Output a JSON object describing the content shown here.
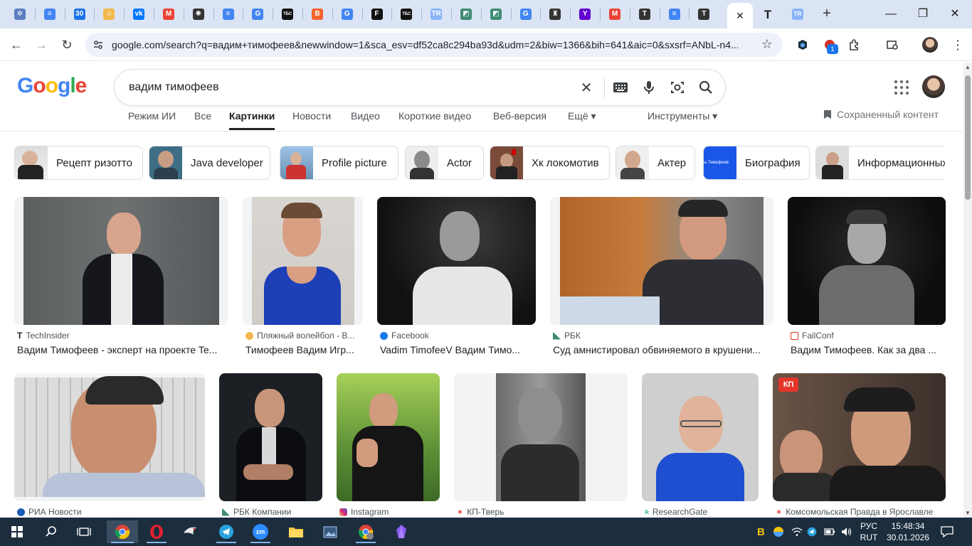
{
  "browser": {
    "tabs": [
      {
        "icon": "puzzle-tab-icon",
        "color": "#5b7fbf",
        "glyph": "✲"
      },
      {
        "icon": "docs-tab-icon",
        "color": "#4285f4",
        "glyph": "≡"
      },
      {
        "icon": "calendar-tab-icon",
        "color": "#1a73e8",
        "glyph": "30"
      },
      {
        "icon": "smiley-tab-icon",
        "color": "#f2b84b",
        "glyph": "☺"
      },
      {
        "icon": "vk-tab-icon",
        "color": "#0077ff",
        "glyph": "vk"
      },
      {
        "icon": "gmail-tab-icon",
        "color": "#ea4335",
        "glyph": "M"
      },
      {
        "icon": "chatgpt-tab-icon",
        "color": "#333333",
        "glyph": "✺"
      },
      {
        "icon": "docs-tab-icon",
        "color": "#4285f4",
        "glyph": "≡"
      },
      {
        "icon": "google-tab-icon",
        "color": "#4285f4",
        "glyph": "G"
      },
      {
        "icon": "tbc-tab-icon",
        "color": "#111111",
        "glyph": "ТБС"
      },
      {
        "icon": "blogger-tab-icon",
        "color": "#f4642c",
        "glyph": "B"
      },
      {
        "icon": "google-tab-icon",
        "color": "#4285f4",
        "glyph": "G"
      },
      {
        "icon": "f-tab-icon",
        "color": "#111111",
        "glyph": "F"
      },
      {
        "icon": "tbc-tab-icon",
        "color": "#111111",
        "glyph": "ТБС"
      },
      {
        "icon": "tr-tab-icon",
        "color": "#8ab4f8",
        "glyph": "TR"
      },
      {
        "icon": "rbc-tab-icon",
        "color": "#3d8b73",
        "glyph": "◩"
      },
      {
        "icon": "rbc-tab-icon",
        "color": "#3d8b73",
        "glyph": "◩"
      },
      {
        "icon": "google-tab-icon",
        "color": "#4285f4",
        "glyph": "G"
      },
      {
        "icon": "pin-tab-icon",
        "color": "#333333",
        "glyph": "♜"
      },
      {
        "icon": "yahoo-tab-icon",
        "color": "#6001d2",
        "glyph": "Y"
      },
      {
        "icon": "gmail-tab-icon",
        "color": "#ea4335",
        "glyph": "M"
      },
      {
        "icon": "t-tab-icon",
        "color": "#333333",
        "glyph": "T"
      },
      {
        "icon": "docs-tab-icon",
        "color": "#4285f4",
        "glyph": "≡"
      },
      {
        "icon": "t-tab-icon",
        "color": "#333333",
        "glyph": "T"
      }
    ],
    "active_tab_close": "✕",
    "after_tabs": [
      {
        "icon": "t-tab-icon",
        "glyph": "T"
      },
      {
        "icon": "tr-tab-icon",
        "glyph": "TR"
      }
    ],
    "new_tab": "+",
    "url": "google.com/search?q=вадим+тимофеев&newwindow=1&sca_esv=df52ca8c294ba93d&udm=2&biw=1366&bih=641&aic=0&sxsrf=ANbL-n4...",
    "extension_badge": "1"
  },
  "search": {
    "query": "вадим тимофеев",
    "logo": [
      "G",
      "o",
      "o",
      "g",
      "l",
      "e"
    ],
    "logo_colors": [
      "#4285f4",
      "#ea4335",
      "#fbbc05",
      "#4285f4",
      "#34a853",
      "#ea4335"
    ]
  },
  "nav": {
    "tabs": [
      "Режим ИИ",
      "Все",
      "Картинки",
      "Новости",
      "Видео",
      "Короткие видео",
      "Веб-версия",
      "Ещё ▾"
    ],
    "tools": "Инструменты ▾",
    "saved": "Сохраненный контент"
  },
  "chips": [
    "Рецепт ризотто",
    "Java developer",
    "Profile picture",
    "Actor",
    "Хк локомотив",
    "Актер",
    "Биография",
    "Информационных"
  ],
  "chip_thumb_text": "ы Тимофеев",
  "results": [
    {
      "source": "TechInsider",
      "title": "Вадим Тимофеев - эксперт на проекте Te...",
      "src_color": "#202124",
      "src_glyph": "T"
    },
    {
      "source": "Пляжный волейбол - В...",
      "title": "Тимофеев Вадим Игр...",
      "src_color": "#f2b84b",
      "src_glyph": ""
    },
    {
      "source": "Facebook",
      "title": "Vadim TimofeeV Вадим Тимо...",
      "src_color": "#1877f2",
      "src_glyph": ""
    },
    {
      "source": "РБК",
      "title": "Суд амнистировал обвиняемого в крушени...",
      "src_color": "#3d8b73",
      "src_glyph": ""
    },
    {
      "source": "FailConf",
      "title": "Вадим Тимофеев. Как за два ...",
      "src_color": "#d93025",
      "src_glyph": ""
    },
    {
      "source": "РИА Новости",
      "title": "",
      "src_color": "#1a5fb4",
      "src_glyph": ""
    },
    {
      "source": "РБК Компании",
      "title": "",
      "src_color": "#3d8b73",
      "src_glyph": ""
    },
    {
      "source": "Instagram",
      "title": "",
      "src_color": "#d62976",
      "src_glyph": ""
    },
    {
      "source": "КП-Тверь",
      "title": "",
      "src_color": "#e5352b",
      "src_glyph": ""
    },
    {
      "source": "ResearchGate",
      "title": "",
      "src_color": "#40ba9b",
      "src_glyph": ""
    },
    {
      "source": "Комсомольская Правда в Ярославле",
      "title": "",
      "src_color": "#e5352b",
      "src_glyph": ""
    }
  ],
  "kp_logo": "КП",
  "taskbar": {
    "apps": [
      "windows-start-icon",
      "search-icon",
      "task-view-icon",
      "chrome-icon",
      "opera-icon",
      "bird-icon",
      "telegram-icon",
      "zoom-icon",
      "folder-icon",
      "photo-icon",
      "chrome-profile-icon",
      "obsidian-icon"
    ],
    "zoom_label": "zm",
    "lang": "РУС",
    "lang2": "RUT",
    "time": "15:48:34",
    "date": "30.01.2026",
    "yandex_glyph": "B"
  }
}
